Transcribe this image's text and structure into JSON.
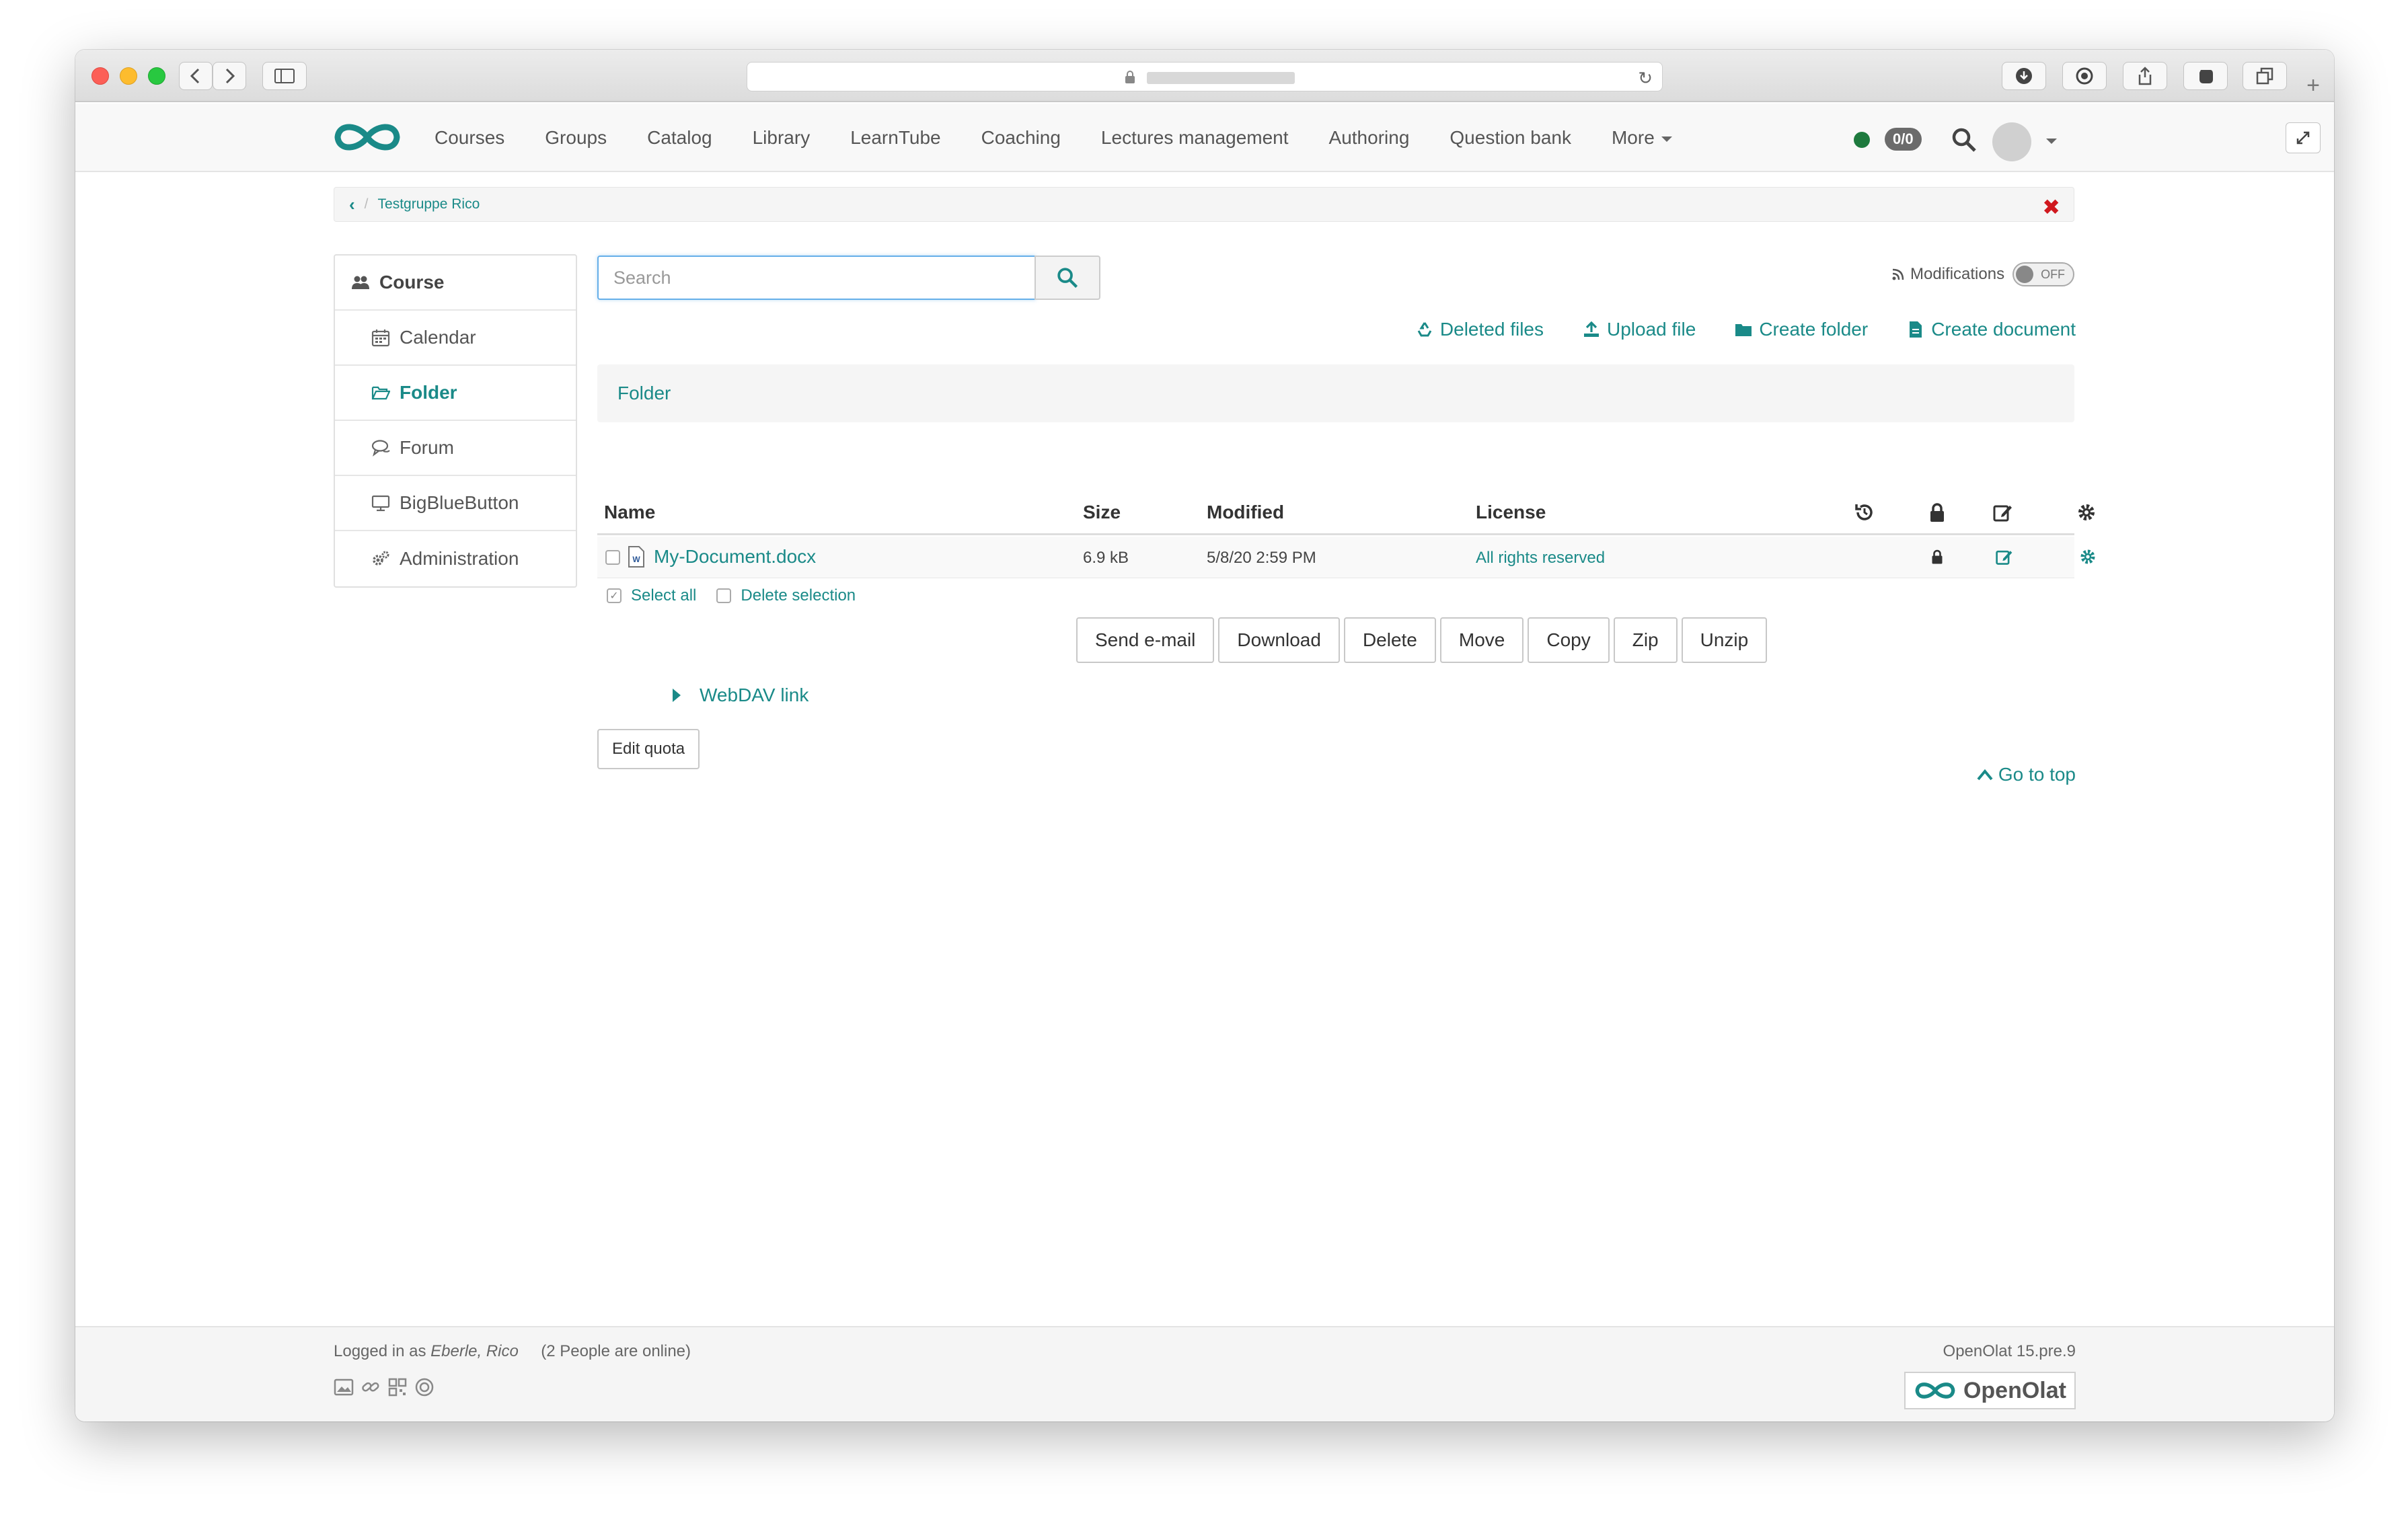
{
  "nav": {
    "items": [
      "Courses",
      "Groups",
      "Catalog",
      "Library",
      "LearnTube",
      "Coaching",
      "Lectures management",
      "Authoring",
      "Question bank",
      "More"
    ],
    "badge": "0/0"
  },
  "breadcrumb": {
    "current": "Testgruppe Rico"
  },
  "sidebar": {
    "items": [
      {
        "label": "Course",
        "icon": "users-icon"
      },
      {
        "label": "Calendar",
        "icon": "calendar-icon"
      },
      {
        "label": "Folder",
        "icon": "folder-open-icon"
      },
      {
        "label": "Forum",
        "icon": "chat-icon"
      },
      {
        "label": "BigBlueButton",
        "icon": "monitor-icon"
      },
      {
        "label": "Administration",
        "icon": "gears-icon"
      }
    ]
  },
  "search": {
    "placeholder": "Search"
  },
  "modifications": {
    "label": "Modifications",
    "state": "OFF"
  },
  "actions": {
    "deleted_files": "Deleted files",
    "upload_file": "Upload file",
    "create_folder": "Create folder",
    "create_document": "Create document"
  },
  "folder_title": "Folder",
  "table": {
    "headers": {
      "name": "Name",
      "size": "Size",
      "modified": "Modified",
      "license": "License"
    },
    "rows": [
      {
        "name": "My-Document.docx",
        "size": "6.9 kB",
        "modified": "5/8/20 2:59 PM",
        "license": "All rights reserved"
      }
    ]
  },
  "selection": {
    "select_all": "Select all",
    "delete_selection": "Delete selection"
  },
  "buttons": [
    "Send e-mail",
    "Download",
    "Delete",
    "Move",
    "Copy",
    "Zip",
    "Unzip"
  ],
  "webdav_link": "WebDAV link",
  "edit_quota": "Edit quota",
  "go_to_top": "Go to top",
  "footer": {
    "logged_in_prefix": "Logged in as",
    "user": "Eberle, Rico",
    "online": "(2 People are online)",
    "version": "OpenOlat 15.pre.9",
    "brand": "OpenOlat"
  },
  "colors": {
    "accent": "#1a8a88",
    "status_online": "#1e7a3e",
    "close": "#d0191f"
  }
}
